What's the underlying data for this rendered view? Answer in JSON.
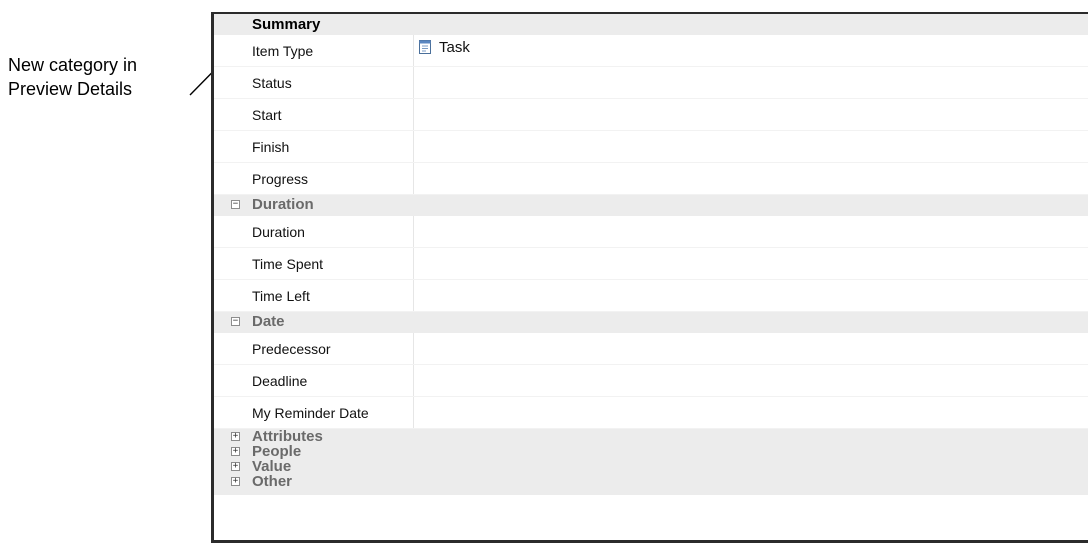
{
  "annotation": {
    "line1": "New category in",
    "line2": "Preview Details"
  },
  "categories": [
    {
      "label": "Summary",
      "toggle": "",
      "props": [
        {
          "name": "Item Type",
          "value": "Task"
        },
        {
          "name": "Status",
          "value": ""
        },
        {
          "name": "Start",
          "value": ""
        },
        {
          "name": "Finish",
          "value": ""
        },
        {
          "name": "Progress",
          "value": ""
        }
      ]
    },
    {
      "label": "Duration",
      "toggle": "−",
      "props": [
        {
          "name": "Duration",
          "value": ""
        },
        {
          "name": "Time Spent",
          "value": ""
        },
        {
          "name": "Time Left",
          "value": ""
        }
      ]
    },
    {
      "label": "Date",
      "toggle": "−",
      "props": [
        {
          "name": "Predecessor",
          "value": ""
        },
        {
          "name": "Deadline",
          "value": ""
        },
        {
          "name": "My Reminder Date",
          "value": ""
        }
      ]
    },
    {
      "label": "Attributes",
      "toggle": "+"
    },
    {
      "label": "People",
      "toggle": "+"
    },
    {
      "label": "Value",
      "toggle": "+"
    },
    {
      "label": "Other",
      "toggle": "+"
    }
  ],
  "icons": {
    "task": "task-icon",
    "expand": "expand-icon",
    "collapse": "collapse-icon"
  }
}
